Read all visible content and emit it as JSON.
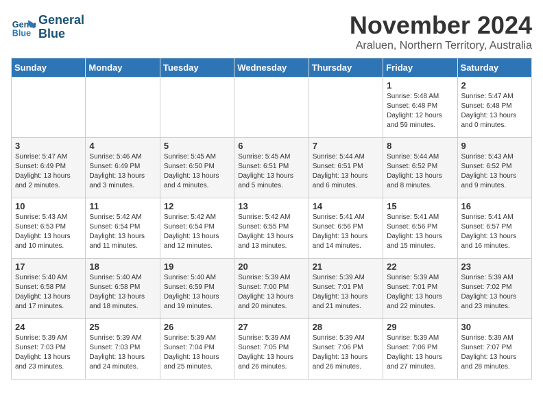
{
  "header": {
    "logo_line1": "General",
    "logo_line2": "Blue",
    "month_title": "November 2024",
    "subtitle": "Araluen, Northern Territory, Australia"
  },
  "days_of_week": [
    "Sunday",
    "Monday",
    "Tuesday",
    "Wednesday",
    "Thursday",
    "Friday",
    "Saturday"
  ],
  "weeks": [
    [
      {
        "day": "",
        "info": ""
      },
      {
        "day": "",
        "info": ""
      },
      {
        "day": "",
        "info": ""
      },
      {
        "day": "",
        "info": ""
      },
      {
        "day": "",
        "info": ""
      },
      {
        "day": "1",
        "info": "Sunrise: 5:48 AM\nSunset: 6:48 PM\nDaylight: 12 hours\nand 59 minutes."
      },
      {
        "day": "2",
        "info": "Sunrise: 5:47 AM\nSunset: 6:48 PM\nDaylight: 13 hours\nand 0 minutes."
      }
    ],
    [
      {
        "day": "3",
        "info": "Sunrise: 5:47 AM\nSunset: 6:49 PM\nDaylight: 13 hours\nand 2 minutes."
      },
      {
        "day": "4",
        "info": "Sunrise: 5:46 AM\nSunset: 6:49 PM\nDaylight: 13 hours\nand 3 minutes."
      },
      {
        "day": "5",
        "info": "Sunrise: 5:45 AM\nSunset: 6:50 PM\nDaylight: 13 hours\nand 4 minutes."
      },
      {
        "day": "6",
        "info": "Sunrise: 5:45 AM\nSunset: 6:51 PM\nDaylight: 13 hours\nand 5 minutes."
      },
      {
        "day": "7",
        "info": "Sunrise: 5:44 AM\nSunset: 6:51 PM\nDaylight: 13 hours\nand 6 minutes."
      },
      {
        "day": "8",
        "info": "Sunrise: 5:44 AM\nSunset: 6:52 PM\nDaylight: 13 hours\nand 8 minutes."
      },
      {
        "day": "9",
        "info": "Sunrise: 5:43 AM\nSunset: 6:52 PM\nDaylight: 13 hours\nand 9 minutes."
      }
    ],
    [
      {
        "day": "10",
        "info": "Sunrise: 5:43 AM\nSunset: 6:53 PM\nDaylight: 13 hours\nand 10 minutes."
      },
      {
        "day": "11",
        "info": "Sunrise: 5:42 AM\nSunset: 6:54 PM\nDaylight: 13 hours\nand 11 minutes."
      },
      {
        "day": "12",
        "info": "Sunrise: 5:42 AM\nSunset: 6:54 PM\nDaylight: 13 hours\nand 12 minutes."
      },
      {
        "day": "13",
        "info": "Sunrise: 5:42 AM\nSunset: 6:55 PM\nDaylight: 13 hours\nand 13 minutes."
      },
      {
        "day": "14",
        "info": "Sunrise: 5:41 AM\nSunset: 6:56 PM\nDaylight: 13 hours\nand 14 minutes."
      },
      {
        "day": "15",
        "info": "Sunrise: 5:41 AM\nSunset: 6:56 PM\nDaylight: 13 hours\nand 15 minutes."
      },
      {
        "day": "16",
        "info": "Sunrise: 5:41 AM\nSunset: 6:57 PM\nDaylight: 13 hours\nand 16 minutes."
      }
    ],
    [
      {
        "day": "17",
        "info": "Sunrise: 5:40 AM\nSunset: 6:58 PM\nDaylight: 13 hours\nand 17 minutes."
      },
      {
        "day": "18",
        "info": "Sunrise: 5:40 AM\nSunset: 6:58 PM\nDaylight: 13 hours\nand 18 minutes."
      },
      {
        "day": "19",
        "info": "Sunrise: 5:40 AM\nSunset: 6:59 PM\nDaylight: 13 hours\nand 19 minutes."
      },
      {
        "day": "20",
        "info": "Sunrise: 5:39 AM\nSunset: 7:00 PM\nDaylight: 13 hours\nand 20 minutes."
      },
      {
        "day": "21",
        "info": "Sunrise: 5:39 AM\nSunset: 7:01 PM\nDaylight: 13 hours\nand 21 minutes."
      },
      {
        "day": "22",
        "info": "Sunrise: 5:39 AM\nSunset: 7:01 PM\nDaylight: 13 hours\nand 22 minutes."
      },
      {
        "day": "23",
        "info": "Sunrise: 5:39 AM\nSunset: 7:02 PM\nDaylight: 13 hours\nand 23 minutes."
      }
    ],
    [
      {
        "day": "24",
        "info": "Sunrise: 5:39 AM\nSunset: 7:03 PM\nDaylight: 13 hours\nand 23 minutes."
      },
      {
        "day": "25",
        "info": "Sunrise: 5:39 AM\nSunset: 7:03 PM\nDaylight: 13 hours\nand 24 minutes."
      },
      {
        "day": "26",
        "info": "Sunrise: 5:39 AM\nSunset: 7:04 PM\nDaylight: 13 hours\nand 25 minutes."
      },
      {
        "day": "27",
        "info": "Sunrise: 5:39 AM\nSunset: 7:05 PM\nDaylight: 13 hours\nand 26 minutes."
      },
      {
        "day": "28",
        "info": "Sunrise: 5:39 AM\nSunset: 7:06 PM\nDaylight: 13 hours\nand 26 minutes."
      },
      {
        "day": "29",
        "info": "Sunrise: 5:39 AM\nSunset: 7:06 PM\nDaylight: 13 hours\nand 27 minutes."
      },
      {
        "day": "30",
        "info": "Sunrise: 5:39 AM\nSunset: 7:07 PM\nDaylight: 13 hours\nand 28 minutes."
      }
    ]
  ]
}
